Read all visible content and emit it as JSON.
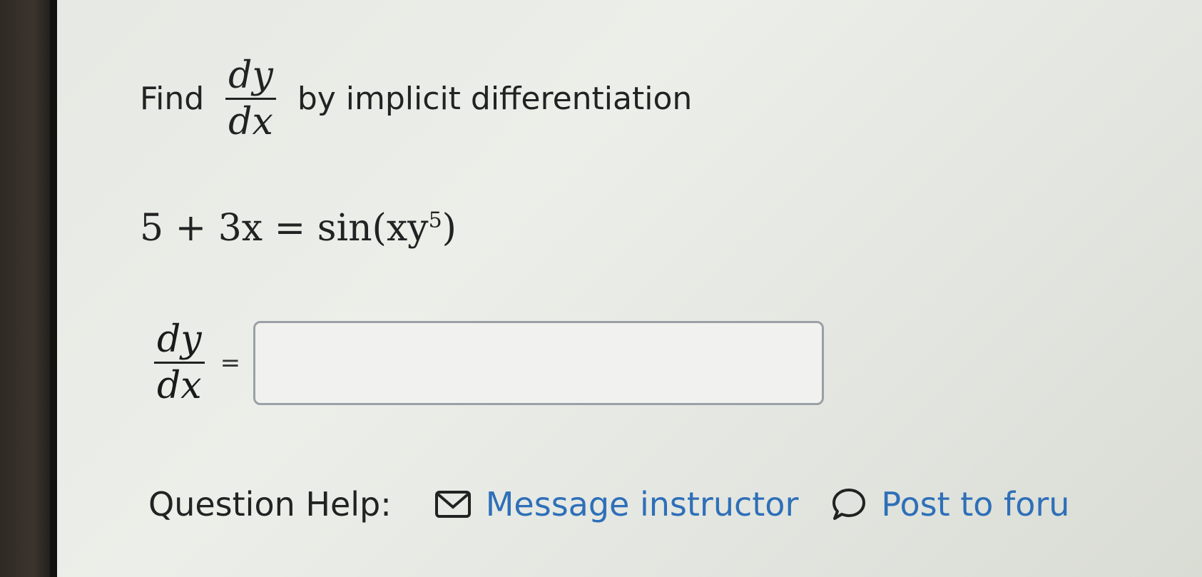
{
  "question": {
    "find_label": "Find",
    "fraction_numerator": "dy",
    "fraction_denominator": "dx",
    "instruction": "by implicit differentiation",
    "equation_left": "5 + 3x = sin(xy",
    "equation_exponent": "5",
    "equation_right": ")"
  },
  "answer": {
    "numerator": "dy",
    "denominator": "dx",
    "equals": "=",
    "value": "",
    "placeholder": ""
  },
  "help": {
    "label": "Question Help:",
    "message_instructor": "Message instructor",
    "post_to_forum": "Post to foru",
    "message_icon": "envelope-icon",
    "forum_icon": "speech-bubble-icon"
  },
  "colors": {
    "link": "#2e6fb8",
    "input_border": "#9aa0a6"
  }
}
